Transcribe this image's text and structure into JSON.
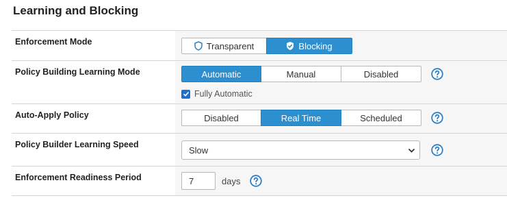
{
  "section": {
    "title": "Learning and Blocking"
  },
  "rows": {
    "enforcement_mode": {
      "label": "Enforcement Mode",
      "options": [
        "Transparent",
        "Blocking"
      ],
      "selected": "Blocking"
    },
    "learning_mode": {
      "label": "Policy Building Learning Mode",
      "options": [
        "Automatic",
        "Manual",
        "Disabled"
      ],
      "selected": "Automatic",
      "checkbox_label": "Fully Automatic",
      "checkbox_checked": true
    },
    "auto_apply": {
      "label": "Auto-Apply Policy",
      "options": [
        "Disabled",
        "Real Time",
        "Scheduled"
      ],
      "selected": "Real Time"
    },
    "learning_speed": {
      "label": "Policy Builder Learning Speed",
      "value": "Slow"
    },
    "readiness": {
      "label": "Enforcement Readiness Period",
      "value": "7",
      "unit": "days"
    }
  },
  "icons": {
    "help": "question-circle-icon",
    "transparent": "shield-outline-icon",
    "blocking": "shield-check-icon"
  },
  "colors": {
    "accent": "#2b8fd0",
    "help": "#2b7fc4",
    "checkbox": "#1f6fd1"
  }
}
